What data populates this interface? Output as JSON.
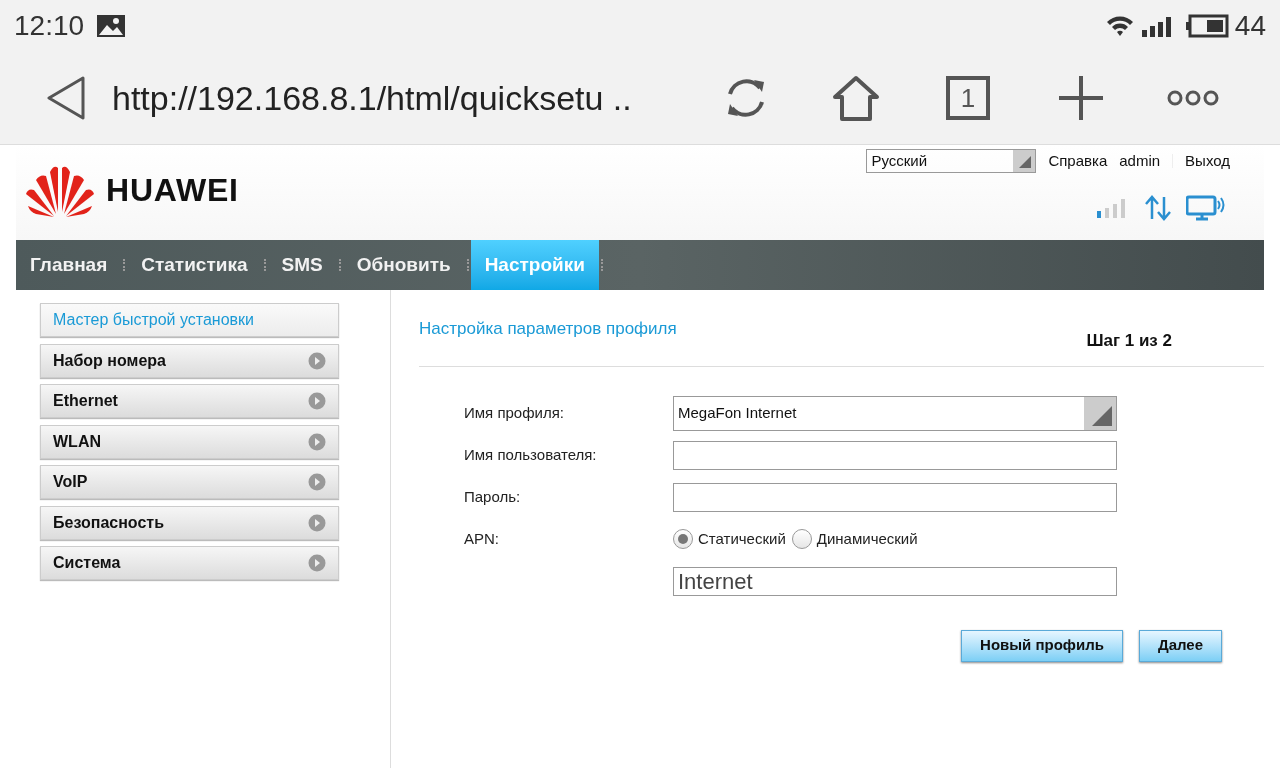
{
  "status_bar": {
    "time": "12:10",
    "battery": "44"
  },
  "browser": {
    "url": "http://192.168.8.1/html/quicksetu ..",
    "tab_count": "1"
  },
  "header": {
    "brand": "HUAWEI",
    "language": "Русский",
    "links": [
      "Справка",
      "admin",
      "Выход"
    ]
  },
  "nav": [
    {
      "label": "Главная",
      "selected": false
    },
    {
      "label": "Статистика",
      "selected": false
    },
    {
      "label": "SMS",
      "selected": false
    },
    {
      "label": "Обновить",
      "selected": false
    },
    {
      "label": "Настройки",
      "selected": true
    }
  ],
  "sidebar": {
    "items": [
      {
        "label": "Мастер быстрой установки",
        "selected": true
      },
      {
        "label": "Набор номера",
        "selected": false
      },
      {
        "label": "Ethernet",
        "selected": false
      },
      {
        "label": "WLAN",
        "selected": false
      },
      {
        "label": "VoIP",
        "selected": false
      },
      {
        "label": "Безопасность",
        "selected": false
      },
      {
        "label": "Система",
        "selected": false
      }
    ]
  },
  "content": {
    "title": "Настройка параметров профиля",
    "step": "Шаг 1 из 2",
    "form": [
      {
        "kind": "select",
        "label": "Имя профиля:",
        "value": "MegaFon Internet"
      },
      {
        "kind": "text",
        "label": "Имя пользователя:"
      },
      {
        "kind": "text",
        "label": "Пароль:"
      },
      {
        "kind": "radio",
        "label": "APN:",
        "options": [
          {
            "label": "Статический",
            "selected": true
          },
          {
            "label": "Динамический",
            "selected": false
          }
        ]
      },
      {
        "kind": "text",
        "value": "Internet"
      }
    ],
    "buttons": [
      "Новый профиль",
      "Далее"
    ]
  }
}
